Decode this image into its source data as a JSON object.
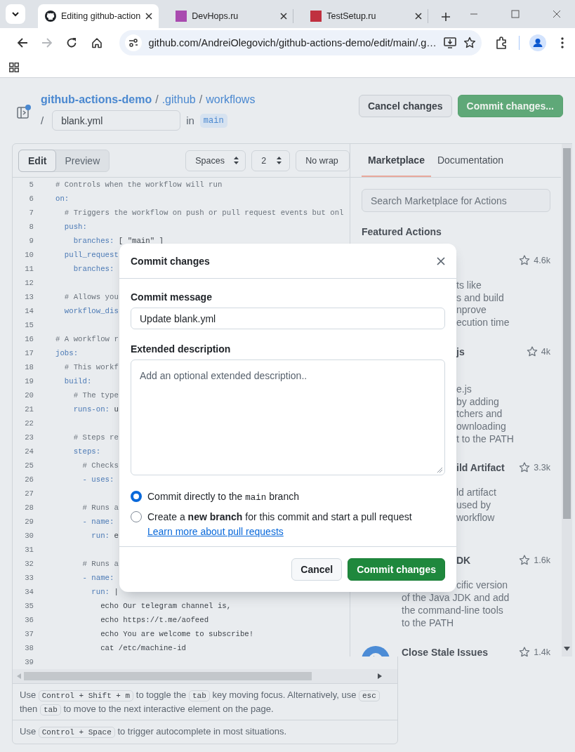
{
  "browser": {
    "tabs": [
      {
        "title": "Editing github-action",
        "selected": true,
        "kind": "logo"
      },
      {
        "title": "DevHops.ru",
        "selected": false,
        "kind": "square",
        "color": "#a94aaf"
      },
      {
        "title": "TestSetup.ru",
        "selected": false,
        "kind": "square",
        "color": "#c0303f"
      }
    ],
    "url": "github.com/AndreiOlegovich/github-actions-demo/edit/main/.g…",
    "forward_disabled": true
  },
  "header": {
    "breadcrumb": [
      {
        "text": "github-actions-demo",
        "kind": "repo"
      },
      {
        "text": "/",
        "kind": "separator"
      },
      {
        "text": ".github",
        "kind": "folder"
      },
      {
        "text": "/",
        "kind": "separator"
      },
      {
        "text": "workflows",
        "kind": "folder"
      }
    ],
    "path_separator": "/",
    "filename": "blank.yml",
    "in_label": "in",
    "branch": "main",
    "buttons": [
      {
        "label": "Cancel changes",
        "kind": "secondary"
      },
      {
        "label": "Commit changes...",
        "kind": "primary"
      }
    ]
  },
  "editor": {
    "modes": [
      {
        "label": "Edit",
        "selected": true
      },
      {
        "label": "Preview",
        "selected": false
      }
    ],
    "indent_mode": "Spaces",
    "indent_size": "2",
    "wrap_mode": "No wrap",
    "lines": [
      {
        "number": "5",
        "text": "# Controls when the workflow will run",
        "kind": "comment"
      },
      {
        "number": "6",
        "text": "on:",
        "kind": "code"
      },
      {
        "number": "7",
        "text": "  # Triggers the workflow on push or pull request events but onl",
        "kind": "comment"
      },
      {
        "number": "8",
        "text": "  push:",
        "kind": "code"
      },
      {
        "number": "9",
        "text": "    branches: [ \"main\" ]",
        "kind": "code"
      },
      {
        "number": "10",
        "text": "  pull_request",
        "kind": "key"
      },
      {
        "number": "11",
        "text": "    branches:",
        "kind": "code"
      },
      {
        "number": "12",
        "kind": "blank"
      },
      {
        "number": "13",
        "text": "  # Allows you",
        "kind": "comment"
      },
      {
        "number": "14",
        "text": "  workflow_dis",
        "kind": "key"
      },
      {
        "number": "15",
        "kind": "blank"
      },
      {
        "number": "16",
        "text": "# A workflow r",
        "kind": "comment"
      },
      {
        "number": "17",
        "text": "jobs:",
        "kind": "code"
      },
      {
        "number": "18",
        "text": "  # This workf",
        "kind": "comment"
      },
      {
        "number": "19",
        "text": "  build:",
        "kind": "code"
      },
      {
        "number": "20",
        "text": "    # The type",
        "kind": "comment"
      },
      {
        "number": "21",
        "text": "    runs-on: u",
        "kind": "code"
      },
      {
        "number": "22",
        "kind": "blank"
      },
      {
        "number": "23",
        "text": "    # Steps re",
        "kind": "comment"
      },
      {
        "number": "24",
        "text": "    steps:",
        "kind": "code"
      },
      {
        "number": "25",
        "text": "      # Checks",
        "kind": "comment"
      },
      {
        "number": "26",
        "text": "      - uses:",
        "kind": "code"
      },
      {
        "number": "27",
        "kind": "blank"
      },
      {
        "number": "28",
        "text": "      # Runs a",
        "kind": "comment"
      },
      {
        "number": "29",
        "text": "      - name:",
        "kind": "code"
      },
      {
        "number": "30",
        "text": "        run: e",
        "kind": "code"
      },
      {
        "number": "31",
        "kind": "blank"
      },
      {
        "number": "32",
        "text": "      # Runs a",
        "kind": "comment"
      },
      {
        "number": "33",
        "text": "      - name:",
        "kind": "code"
      },
      {
        "number": "34",
        "text": "        run: |",
        "kind": "code"
      },
      {
        "number": "35",
        "text": "          echo Our telegram channel is,",
        "kind": "plain"
      },
      {
        "number": "36",
        "text": "          echo https://t.me/aofeed",
        "kind": "plain"
      },
      {
        "number": "37",
        "text": "          echo You are welcome to subscribe!",
        "kind": "plain"
      },
      {
        "number": "38",
        "text": "          cat /etc/machine-id",
        "kind": "plain"
      },
      {
        "number": "39",
        "kind": "blank"
      }
    ]
  },
  "help": [
    {
      "parts": [
        {
          "text": "Use",
          "kind": "text"
        },
        {
          "text": "Control + Shift + m",
          "kind": "key"
        },
        {
          "text": "to toggle the",
          "kind": "text"
        },
        {
          "text": "tab",
          "kind": "key"
        },
        {
          "text": "key moving focus. Alternatively, use",
          "kind": "text"
        },
        {
          "text": "esc",
          "kind": "key"
        },
        {
          "text": "then",
          "kind": "text"
        },
        {
          "text": "tab",
          "kind": "key"
        },
        {
          "text": "to move to the next interactive element on the page.",
          "kind": "text"
        }
      ]
    },
    {
      "parts": [
        {
          "text": "Use",
          "kind": "text"
        },
        {
          "text": "Control + Space",
          "kind": "key"
        },
        {
          "text": "to trigger autocomplete in most situations.",
          "kind": "text"
        }
      ]
    }
  ],
  "marketplace": {
    "tabs": [
      {
        "label": "Marketplace",
        "selected": true
      },
      {
        "label": "Documentation",
        "selected": false
      }
    ],
    "search_placeholder": "Search Marketplace for Actions",
    "heading": "Featured Actions",
    "actions": [
      {
        "kind": "covered",
        "stars_count": "4.6k",
        "lines": [
          {
            "text": "ts like",
            "kind": "clipped"
          },
          {
            "text": "s and build",
            "kind": "clipped"
          },
          {
            "text": "nprove",
            "kind": "clipped"
          },
          {
            "text": "ecution time",
            "kind": "clipped"
          }
        ]
      },
      {
        "kind": "covered",
        "title": {
          "text": "js",
          "kind": "clipped"
        },
        "stars_count": "4k",
        "lines": [
          {
            "text": "e.js",
            "kind": "clipped"
          },
          {
            "text": "by adding",
            "kind": "clipped"
          },
          {
            "text": "tchers and",
            "kind": "clipped"
          },
          {
            "text": "ownloading",
            "kind": "clipped"
          },
          {
            "text": "t to the PATH",
            "kind": "clipped"
          }
        ]
      },
      {
        "kind": "covered",
        "title": {
          "text": "ild Artifact",
          "kind": "clipped"
        },
        "stars_count": "3.3k",
        "lines": [
          {
            "text": "ld artifact",
            "kind": "clipped"
          },
          {
            "text": "used by",
            "kind": "clipped"
          },
          {
            "text": "workflow",
            "kind": "clipped"
          }
        ]
      },
      {
        "kind": "covered",
        "title": {
          "text": "DK",
          "kind": "clipped"
        },
        "stars_count": "1.6k",
        "lines": [
          {
            "text": "cific version",
            "kind": "clipped"
          },
          {
            "text": "of the Java JDK and add",
            "kind": "full"
          },
          {
            "text": "the command-line tools",
            "kind": "full"
          },
          {
            "text": "to the PATH",
            "kind": "full"
          }
        ]
      },
      {
        "kind": "visible",
        "title": {
          "text": "Close Stale Issues",
          "kind": "full"
        },
        "stars_count": "1.4k"
      }
    ]
  },
  "dialog": {
    "title": "Commit changes",
    "message_label": "Commit message",
    "message": "Update blank.yml",
    "description_label": "Extended description",
    "description_placeholder": "Add an optional extended description..",
    "options": [
      {
        "selected": true,
        "parts": [
          {
            "text": "Commit directly to the",
            "kind": "text"
          },
          {
            "text": "main",
            "kind": "code"
          },
          {
            "text": "branch",
            "kind": "text"
          }
        ]
      },
      {
        "selected": false,
        "parts": [
          {
            "text": "Create a **new branch** for this commit and start a pull request",
            "kind": "rich"
          },
          {
            "text": "Learn more about pull requests",
            "kind": "link"
          }
        ]
      }
    ],
    "buttons": [
      {
        "label": "Cancel",
        "kind": "secondary"
      },
      {
        "label": "Commit changes",
        "kind": "primary"
      }
    ]
  }
}
